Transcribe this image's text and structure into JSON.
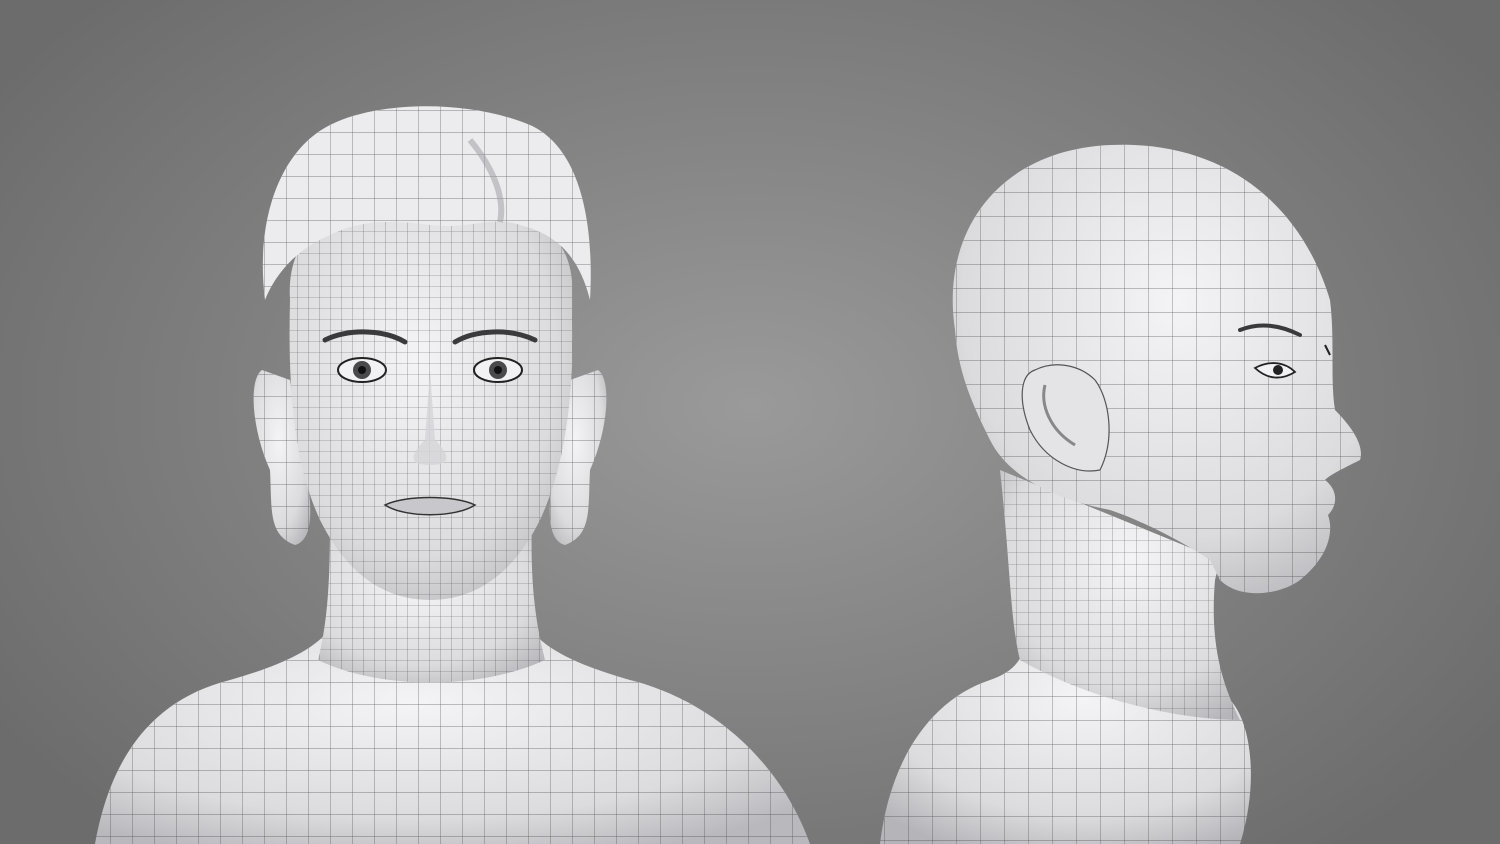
{
  "scene": {
    "background_color": "#858585",
    "mesh_fill": "#e9e9eb",
    "wire_color": "#2c2c2e",
    "views": [
      {
        "id": "front",
        "kind": "front-view-bust"
      },
      {
        "id": "side",
        "kind": "profile-view-bust"
      }
    ]
  }
}
